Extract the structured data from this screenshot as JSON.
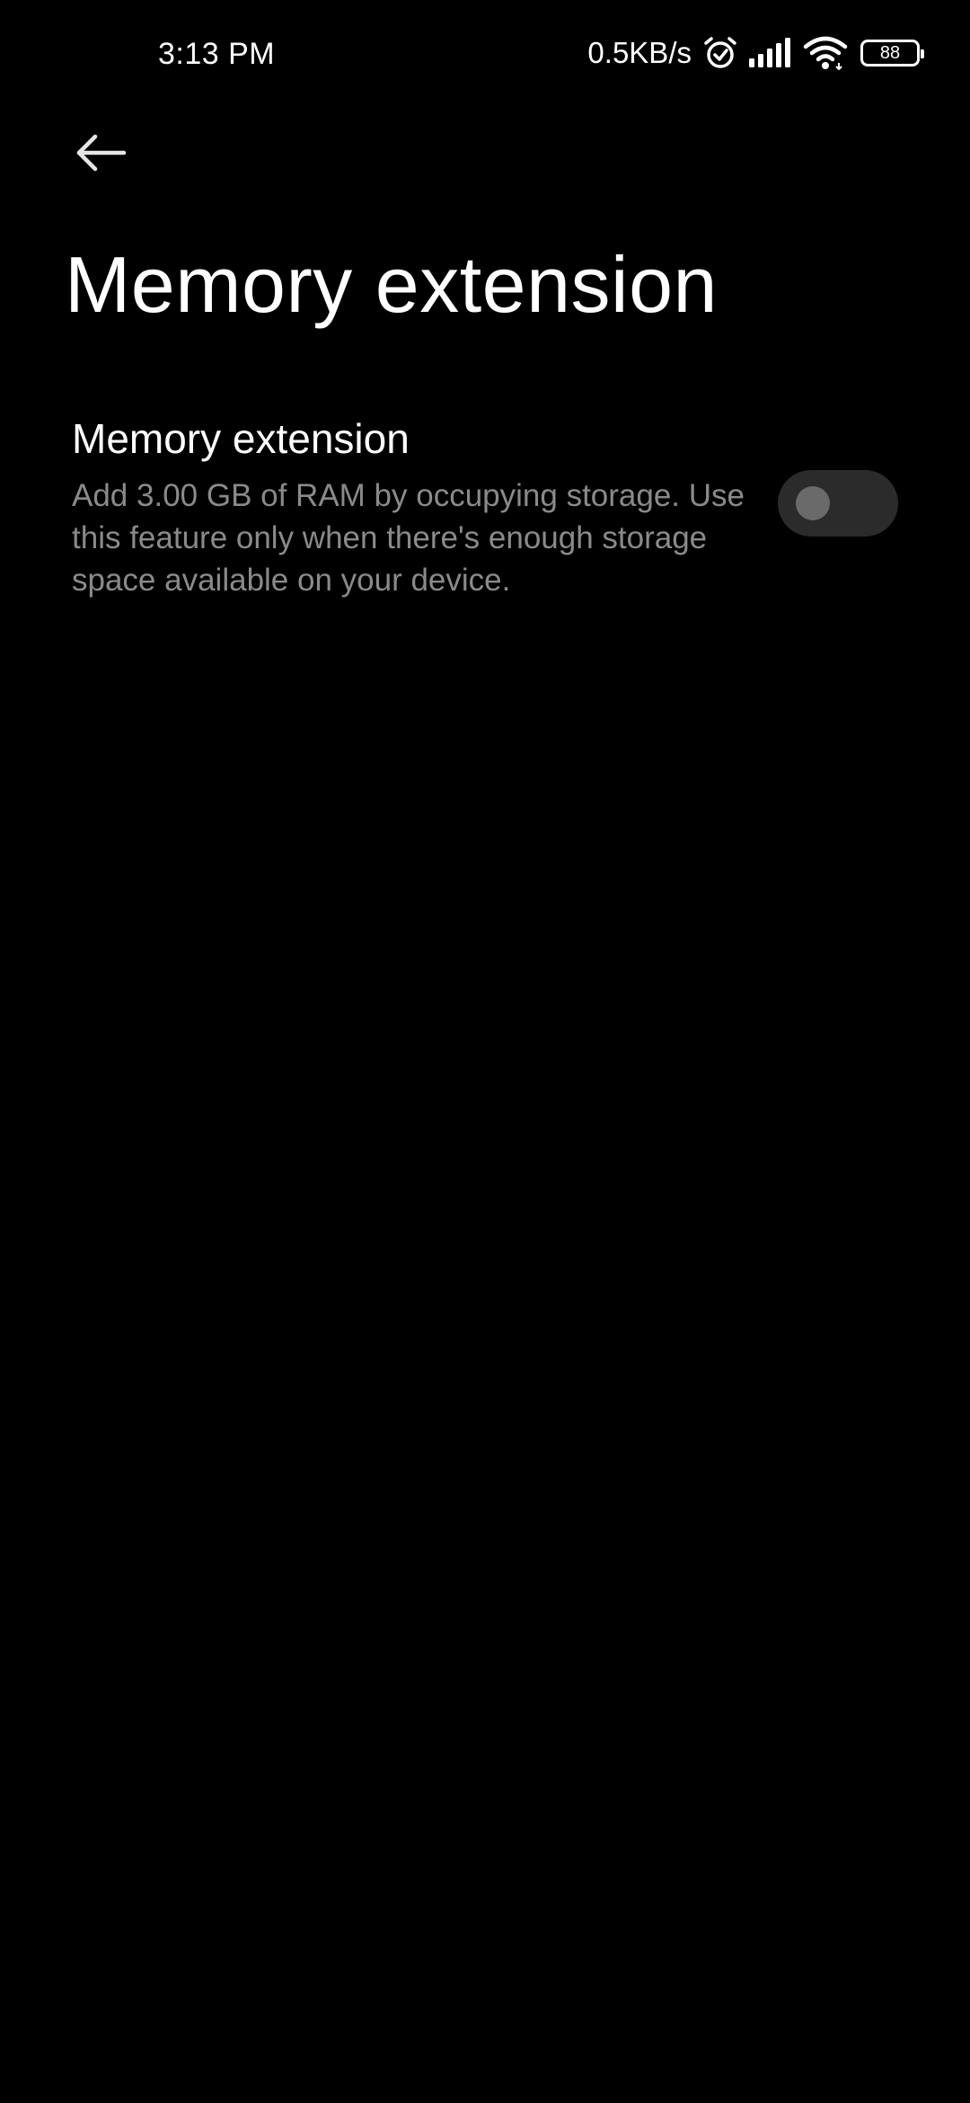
{
  "status_bar": {
    "time": "3:13 PM",
    "network_speed": "0.5KB/s",
    "icons": [
      "alarm-icon",
      "signal-icon",
      "wifi-icon",
      "battery-icon"
    ],
    "battery_level": "88"
  },
  "header": {
    "back_icon": "arrow-left-icon",
    "title": "Memory extension"
  },
  "setting": {
    "title": "Memory extension",
    "summary": "Add 3.00 GB of RAM by occupying storage. Use this feature only when there's enough storage space available on your device.",
    "enabled": false
  },
  "colors": {
    "background": "#000000",
    "text_primary": "#ffffff",
    "text_secondary": "#8a8a8a",
    "toggle_track_off": "#2b2b2b",
    "toggle_knob_off": "#6a6a6a"
  }
}
